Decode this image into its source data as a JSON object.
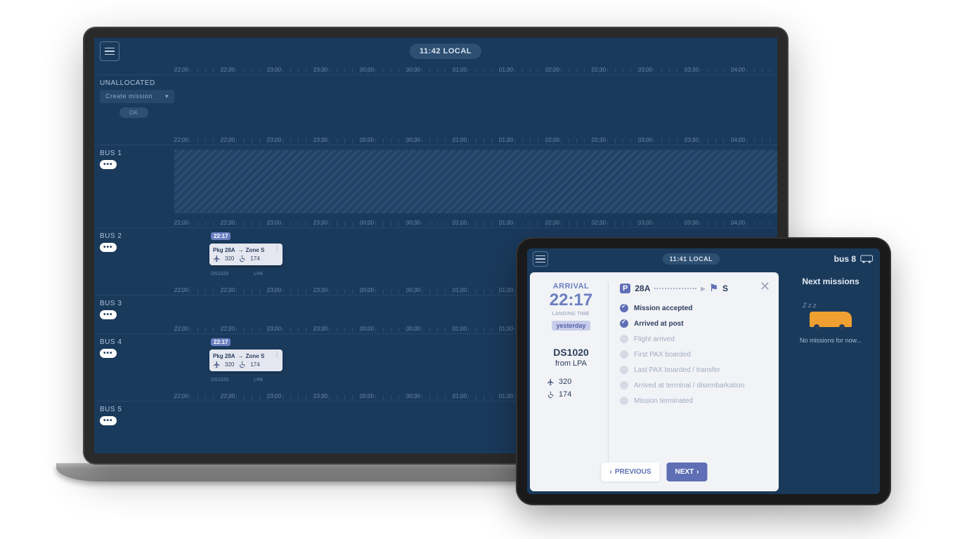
{
  "desktop": {
    "time_pill": "11:42  LOCAL",
    "timeline_ticks": [
      "22:00",
      "22:30",
      "23:00",
      "23:30",
      "00:00",
      "00:30",
      "01:00",
      "01:30",
      "02:00",
      "02:30",
      "03:00",
      "03:30",
      "04:00"
    ],
    "unallocated": {
      "label": "UNALLOCATED",
      "create_mission_label": "Create mission",
      "ok_label": "OK"
    },
    "lanes": [
      {
        "label": "BUS 1",
        "hatched": true
      },
      {
        "label": "BUS 2",
        "mission": true
      },
      {
        "label": "BUS 3"
      },
      {
        "label": "BUS 4",
        "mission": true
      },
      {
        "label": "BUS 5"
      }
    ],
    "mission_card": {
      "time_tag": "22:17",
      "pkg_label": "Pkg",
      "pkg_value": "28A",
      "zone_label": "Zone",
      "zone_value": "S",
      "pax_plane": "320",
      "pax_wheel": "174",
      "sub_left": "DS1020",
      "sub_right": "LPA"
    }
  },
  "tablet": {
    "time_pill": "11:41  LOCAL",
    "bus_label": "bus 8",
    "arrival": {
      "heading": "ARRIVAL",
      "time": "22:17",
      "landing_label": "LANDING TIME",
      "day_tag": "yesterday",
      "flight": "DS1020",
      "from_label": "from LPA",
      "pax_plane": "320",
      "pax_wheel": "174"
    },
    "route": {
      "from": "28A",
      "to": "S"
    },
    "steps": [
      {
        "label": "Mission accepted",
        "done": true
      },
      {
        "label": "Arrived at post",
        "done": true
      },
      {
        "label": "Flight arrived",
        "done": false
      },
      {
        "label": "First PAX boarded",
        "done": false
      },
      {
        "label": "Last PAX boarded / transfer",
        "done": false
      },
      {
        "label": "Arrived at terminal / disembarkation",
        "done": false
      },
      {
        "label": "Mission terminated",
        "done": false
      }
    ],
    "prev_label": "PREVIOUS",
    "next_label": "NEXT",
    "next_missions": {
      "heading": "Next missions",
      "zzz": "Z z z",
      "empty": "No missions for now..."
    }
  }
}
